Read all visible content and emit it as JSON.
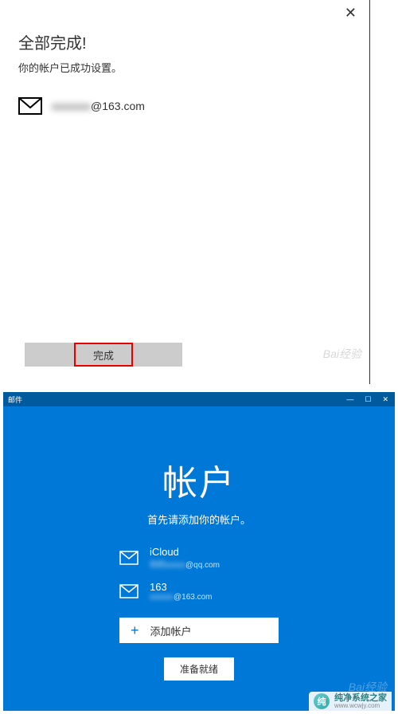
{
  "dialog": {
    "title": "全部完成!",
    "subtitle": "你的帐户已成功设置。",
    "email_hidden": "xxxxxxx",
    "email_visible": "@163.com",
    "done_label": "完成",
    "watermark": "Bai经验"
  },
  "mailapp": {
    "titlebar": "邮件",
    "controls": {
      "min": "—",
      "max": "☐",
      "close": "✕"
    },
    "heading": "帐户",
    "subheading": "首先请添加你的帐户。",
    "accounts": [
      {
        "name": "iCloud",
        "email_hidden": "你的xxxxx",
        "email_visible": "@qq.com"
      },
      {
        "name": "163",
        "email_hidden": "xxxxxx",
        "email_visible": "@163.com"
      }
    ],
    "add_plus": "+",
    "add_label": "添加帐户",
    "ready_label": "准备就绪",
    "watermark": "Bai经验"
  },
  "site": {
    "logo_text": "纯",
    "name": "纯净系统之家",
    "url": "www.wcwjy.com"
  }
}
